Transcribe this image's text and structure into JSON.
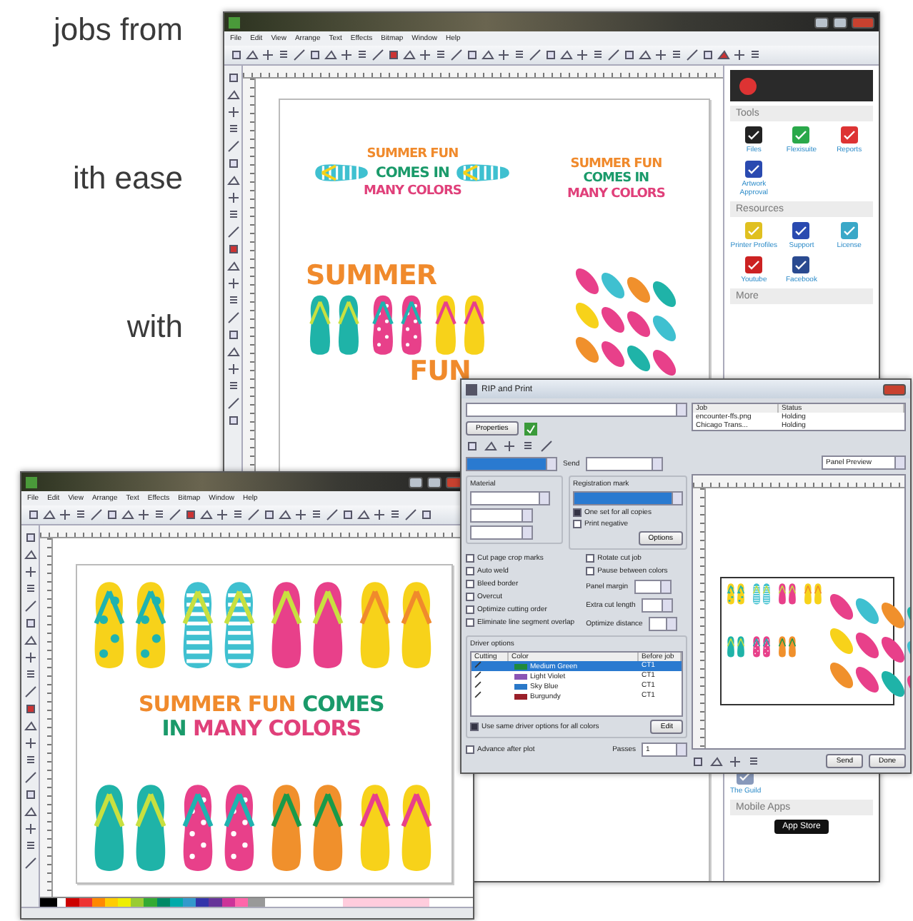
{
  "brochure_text": [
    "jobs from",
    "ith ease",
    "with"
  ],
  "design_window": {
    "menu": [
      "File",
      "Edit",
      "View",
      "Arrange",
      "Text",
      "Effects",
      "Bitmap",
      "Window",
      "Help"
    ],
    "artwork": [
      {
        "kind": "text",
        "lines": [
          {
            "text": "SUMMER FUN",
            "color": "#f08a2c"
          },
          {
            "text": "COMES IN",
            "color": "#1a9a6a"
          },
          {
            "text": "MANY COLORS",
            "color": "#e0407a"
          }
        ],
        "with_flip_flops": true
      },
      {
        "kind": "text",
        "lines": [
          {
            "text": "SUMMER FUN",
            "color": "#f08a2c"
          },
          {
            "text": "COMES IN",
            "color": "#1a9a6a"
          },
          {
            "text": "MANY COLORS",
            "color": "#e0407a"
          }
        ],
        "with_flip_flops": false
      },
      {
        "kind": "title",
        "lines": [
          {
            "text": "SUMMER",
            "color": "#f08a2c"
          },
          {
            "text": "FUN",
            "color": "#f08a2c"
          }
        ]
      },
      {
        "kind": "circle"
      }
    ],
    "sidebar": {
      "sections": [
        {
          "title": "Tools",
          "items": [
            {
              "label": "Files"
            },
            {
              "label": "Flexisuite"
            },
            {
              "label": "Reports"
            },
            {
              "label": "Artwork Approval"
            }
          ]
        },
        {
          "title": "Resources",
          "items": [
            {
              "label": "Printer Profiles"
            },
            {
              "label": "Support"
            },
            {
              "label": "License"
            },
            {
              "label": "Youtube"
            },
            {
              "label": "Facebook"
            }
          ]
        },
        {
          "title": "More"
        }
      ],
      "lower": {
        "guild": "The Guild",
        "mobile_title": "Mobile Apps",
        "store_badge": "App Store"
      }
    }
  },
  "layout_window": {
    "menu": [
      "File",
      "Edit",
      "View",
      "Arrange",
      "Text",
      "Effects",
      "Bitmap",
      "Window",
      "Help"
    ],
    "headline": [
      [
        {
          "text": "SUMMER FUN ",
          "color": "#f08a2c"
        },
        {
          "text": "COMES",
          "color": "#1a9a6a"
        }
      ],
      [
        {
          "text": "IN ",
          "color": "#1a9a6a"
        },
        {
          "text": "MANY COLORS",
          "color": "#e0407a"
        }
      ]
    ]
  },
  "rip_dialog": {
    "title": "RIP and Print",
    "properties_button": "Properties",
    "jobs": {
      "columns": [
        "Job",
        "Status"
      ],
      "rows": [
        {
          "job": "encounter-ffs.png",
          "status": "Holding"
        },
        {
          "job": "Chicago Trans...",
          "status": "Holding"
        }
      ]
    },
    "preview_select": "Panel Preview",
    "send_label": "Send",
    "material_label": "Material",
    "registration_label": "Registration mark",
    "registration_options": [
      {
        "label": "One set for all copies",
        "checked": true
      },
      {
        "label": "Print negative",
        "checked": false
      }
    ],
    "options_button": "Options",
    "cut_options_left": [
      {
        "label": "Cut page crop marks",
        "checked": false
      },
      {
        "label": "Auto weld",
        "checked": false
      },
      {
        "label": "Bleed border",
        "checked": false
      },
      {
        "label": "Overcut",
        "checked": false
      },
      {
        "label": "Optimize cutting order",
        "checked": false
      },
      {
        "label": "Eliminate line segment overlap",
        "checked": false
      }
    ],
    "cut_options_right": [
      {
        "label": "Rotate cut job",
        "checked": false
      },
      {
        "label": "Pause between colors",
        "checked": false
      }
    ],
    "panel_margin_label": "Panel margin",
    "extra_cut_label": "Extra cut length",
    "optimize_distance_label": "Optimize distance",
    "driver_options": {
      "title": "Driver options",
      "columns": [
        "Cutting",
        "Color",
        "Before job"
      ],
      "rows": [
        {
          "color_name": "Medium Green",
          "color": "#1f8a3c",
          "before": "CT1",
          "selected": true
        },
        {
          "color_name": "Light Violet",
          "color": "#8a55b5",
          "before": "CT1",
          "selected": false
        },
        {
          "color_name": "Sky Blue",
          "color": "#2a78c8",
          "before": "CT1",
          "selected": false
        },
        {
          "color_name": "Burgundy",
          "color": "#9a1f2a",
          "before": "CT1",
          "selected": false
        }
      ],
      "same_options": {
        "label": "Use same driver options for all colors",
        "checked": true
      },
      "edit_button": "Edit"
    },
    "advance": {
      "label": "Advance after plot",
      "checked": false
    },
    "passes_label": "Passes",
    "passes_value": "1",
    "buttons": [
      "Send",
      "Done"
    ]
  }
}
